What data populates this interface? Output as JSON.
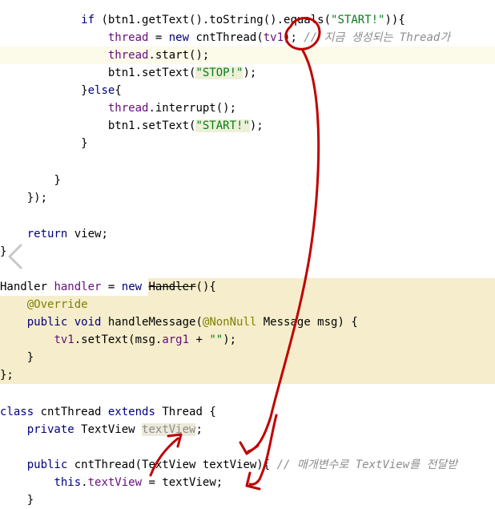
{
  "editor": {
    "lines": {
      "l0": {
        "indent": "            ",
        "kw_if": "if",
        "sp1": " (",
        "var_btn1": "btn1",
        "call": ".getText().toString().equals(",
        "str_start": "\"START!\"",
        "end": ")){"
      },
      "l1": {
        "indent": "                ",
        "field_thread": "thread",
        "op": " = ",
        "kw_new": "new",
        "class_call": " cntThread(",
        "arg_tv1": "tv1",
        "end": "); ",
        "comment": "// 지금 생성되는 Thread가"
      },
      "l2": {
        "indent": "                ",
        "field_thread": "thread",
        "call": ".start();"
      },
      "l3": {
        "indent": "                ",
        "var_btn1": "btn1",
        "call": ".setText(",
        "str_stop": "\"STOP!\"",
        "end": ");"
      },
      "l4": {
        "indent": "            ",
        "text": "}",
        "kw_else": "else",
        "end": "{"
      },
      "l5": {
        "indent": "                ",
        "field_thread": "thread",
        "call": ".interrupt();"
      },
      "l6": {
        "indent": "                ",
        "var_btn1": "btn1",
        "call": ".setText(",
        "str_start": "\"START!\"",
        "end": ");"
      },
      "l7": {
        "indent": "            ",
        "text": "}"
      },
      "l9": {
        "indent": "        ",
        "text": "}"
      },
      "l10": {
        "indent": "    ",
        "text": "});"
      },
      "l12": {
        "indent": "    ",
        "kw_return": "return",
        "rest": " view;"
      },
      "l13": {
        "text": "}"
      },
      "l15": {
        "type": "Handler",
        "sp": " ",
        "field_handler": "handler",
        "op": " = ",
        "kw_new": "new",
        "sp2": " ",
        "struck": "Handler",
        "end": "(){"
      },
      "l16": {
        "indent": "    ",
        "annotation": "@Override"
      },
      "l17": {
        "indent": "    ",
        "kw_public": "public",
        "sp": " ",
        "kw_void": "void",
        "method": " handleMessage(",
        "annotation": "@NonNull",
        "rest": " Message msg) {"
      },
      "l18": {
        "indent": "        ",
        "field_tv1": "tv1",
        "call": ".setText(msg.",
        "field_arg1": "arg1",
        "op": " + ",
        "str_empty": "\"\"",
        "end": ");"
      },
      "l19": {
        "indent": "    ",
        "text": "}"
      },
      "l20": {
        "text": "};"
      },
      "l22": {
        "kw_class": "class",
        "name": " cntThread ",
        "kw_extends": "extends",
        "rest": " Thread {"
      },
      "l23": {
        "indent": "    ",
        "kw_private": "private",
        "type": " TextView ",
        "field_unused": "textView",
        "end": ";"
      },
      "l25": {
        "indent": "    ",
        "kw_public": "public",
        "ctor": " cntThread(TextView textView){ ",
        "comment": "// 매개변수로 TextView를 전달받"
      },
      "l26": {
        "indent": "        ",
        "kw_this": "this",
        "dot": ".",
        "field_textView": "textView",
        "rest": " = textView;"
      },
      "l27": {
        "indent": "    ",
        "text": "}"
      }
    }
  },
  "nav": {
    "icon": "chevron-left-icon"
  },
  "annotation_colors": {
    "ink": "#c00000"
  },
  "colors": {
    "keyword": "#000080",
    "field": "#660e7a",
    "string": "#067d17",
    "annotation": "#808000",
    "comment": "#8c8c8c",
    "highlight": "#f5edcb"
  }
}
